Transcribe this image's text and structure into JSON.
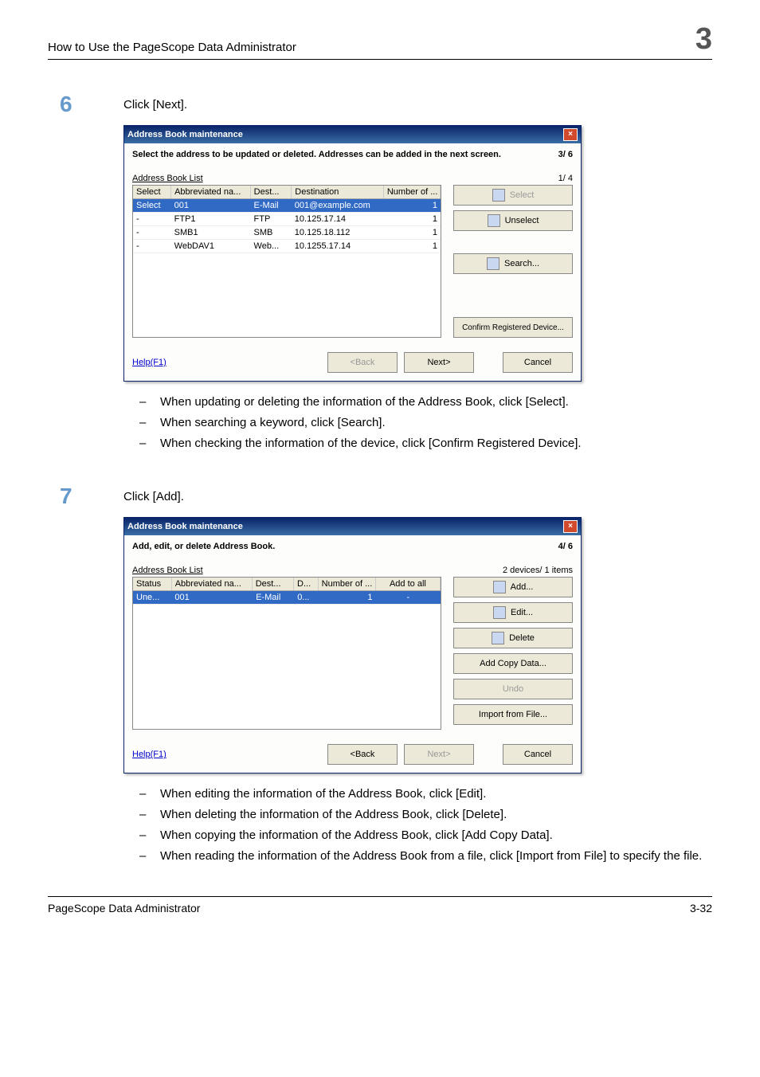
{
  "header": {
    "title": "How to Use the PageScope Data Administrator",
    "chapter": "3"
  },
  "step6": {
    "num": "6",
    "text": "Click [Next].",
    "dialog": {
      "title": "Address Book maintenance",
      "instruction": "Select the address to be updated or deleted.  Addresses can be added in the next screen.",
      "progress": "3/ 6",
      "list_label": "Address Book List",
      "list_count": "1/ 4",
      "columns": [
        "Select",
        "Abbreviated na...",
        "Dest...",
        "Destination",
        "Number of ..."
      ],
      "rows": [
        {
          "sel": true,
          "c1": "Select",
          "c2": "001",
          "c3": "E-Mail",
          "c4": "001@example.com",
          "c5": "1"
        },
        {
          "sel": false,
          "c1": "-",
          "c2": "FTP1",
          "c3": "FTP",
          "c4": "10.125.17.14",
          "c5": "1"
        },
        {
          "sel": false,
          "c1": "-",
          "c2": "SMB1",
          "c3": "SMB",
          "c4": "10.125.18.112",
          "c5": "1"
        },
        {
          "sel": false,
          "c1": "-",
          "c2": "WebDAV1",
          "c3": "Web...",
          "c4": "10.1255.17.14",
          "c5": "1"
        }
      ],
      "btn_select": "Select",
      "btn_unselect": "Unselect",
      "btn_search": "Search...",
      "btn_confirm": "Confirm Registered Device...",
      "help": "Help(F1)",
      "back": "<Back",
      "next": "Next>",
      "cancel": "Cancel"
    },
    "bullets": [
      "When updating or deleting the information of the Address Book, click [Select].",
      "When searching a keyword, click [Search].",
      "When checking the information of the device, click [Confirm Registered Device]."
    ]
  },
  "step7": {
    "num": "7",
    "text": "Click [Add].",
    "dialog": {
      "title": "Address Book maintenance",
      "instruction": "Add, edit, or delete Address Book.",
      "progress": "4/ 6",
      "list_label": "Address Book List",
      "list_count": "2 devices/ 1 items",
      "columns": [
        "Status",
        "Abbreviated na...",
        "Dest...",
        "D...",
        "Number of ...",
        "Add to all"
      ],
      "rows": [
        {
          "sel": true,
          "c1": "Une...",
          "c2": "001",
          "c3": "E-Mail",
          "c4": "0...",
          "c5": "1",
          "c6": "-"
        }
      ],
      "btn_add": "Add...",
      "btn_edit": "Edit...",
      "btn_delete": "Delete",
      "btn_copy": "Add Copy Data...",
      "btn_undo": "Undo",
      "btn_import": "Import from File...",
      "help": "Help(F1)",
      "back": "<Back",
      "next": "Next>",
      "cancel": "Cancel"
    },
    "bullets": [
      "When editing the information of the Address Book, click [Edit].",
      "When deleting the information of the Address Book, click [Delete].",
      "When copying the information of the Address Book, click [Add Copy Data].",
      "When reading the information of the Address Book from a file, click [Import from File] to specify the file."
    ]
  },
  "footer": {
    "left": "PageScope Data Administrator",
    "right": "3-32"
  }
}
